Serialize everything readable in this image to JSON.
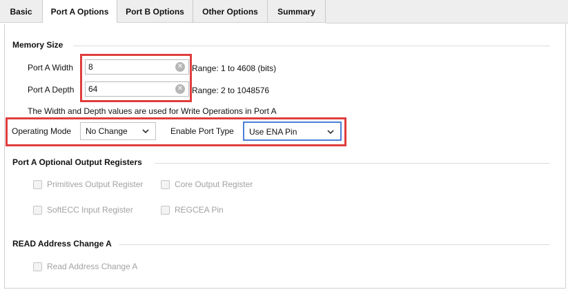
{
  "tabs": [
    {
      "label": "Basic",
      "active": false
    },
    {
      "label": "Port A Options",
      "active": true
    },
    {
      "label": "Port B Options",
      "active": false
    },
    {
      "label": "Other Options",
      "active": false
    },
    {
      "label": "Summary",
      "active": false
    }
  ],
  "memory_size": {
    "title": "Memory Size",
    "width": {
      "label": "Port A Width",
      "value": "8",
      "range": "Range: 1 to 4608 (bits)"
    },
    "depth": {
      "label": "Port A Depth",
      "value": "64",
      "range": "Range: 2 to 1048576"
    },
    "note": "The Width and Depth values are used for Write Operations in Port A"
  },
  "mode": {
    "operating_mode_label": "Operating Mode",
    "operating_mode_value": "No Change",
    "enable_port_label": "Enable Port Type",
    "enable_port_value": "Use ENA Pin"
  },
  "optional_registers": {
    "title": "Port A Optional Output Registers",
    "items": [
      {
        "label": "Primitives Output Register",
        "checked": false,
        "enabled": false
      },
      {
        "label": "Core Output Register",
        "checked": false,
        "enabled": false
      },
      {
        "label": "SoftECC Input Register",
        "checked": false,
        "enabled": false
      },
      {
        "label": "REGCEA Pin",
        "checked": false,
        "enabled": false
      }
    ]
  },
  "read_address": {
    "title": "READ Address Change A",
    "item": {
      "label": "Read Address Change A",
      "checked": false,
      "enabled": false
    }
  },
  "colors": {
    "highlight_red": "#e03c3c",
    "focus_blue": "#4a7fd6",
    "disabled_text": "#a2a2a2"
  },
  "icons": {
    "clear": "clear-circle-x-icon",
    "dropdown": "chevron-down-icon"
  }
}
